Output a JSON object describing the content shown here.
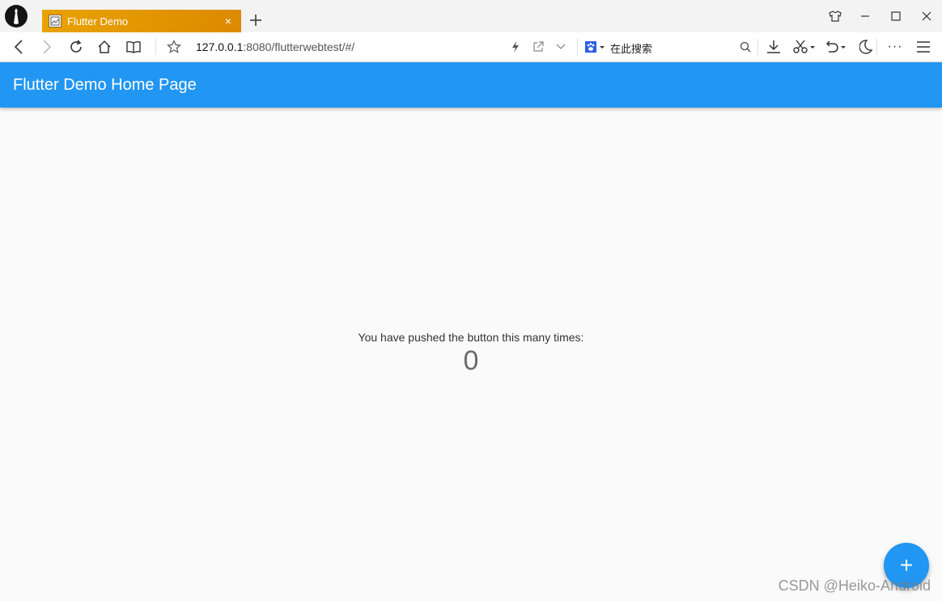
{
  "browser": {
    "tab": {
      "title": "Flutter Demo",
      "close_glyph": "×"
    },
    "new_tab_glyph": "+",
    "address": {
      "host": "127.0.0.1",
      "rest": ":8080/flutterwebtest/#/"
    },
    "search": {
      "engine_icon": "paw-icon",
      "placeholder": "在此搜索"
    },
    "more_glyph": "···"
  },
  "app": {
    "title": "Flutter Demo Home Page",
    "message": "You have pushed the button this many times:",
    "counter": "0",
    "fab_glyph": "+",
    "accent_color": "#2196f3"
  },
  "watermark": "CSDN @Heiko-Android"
}
